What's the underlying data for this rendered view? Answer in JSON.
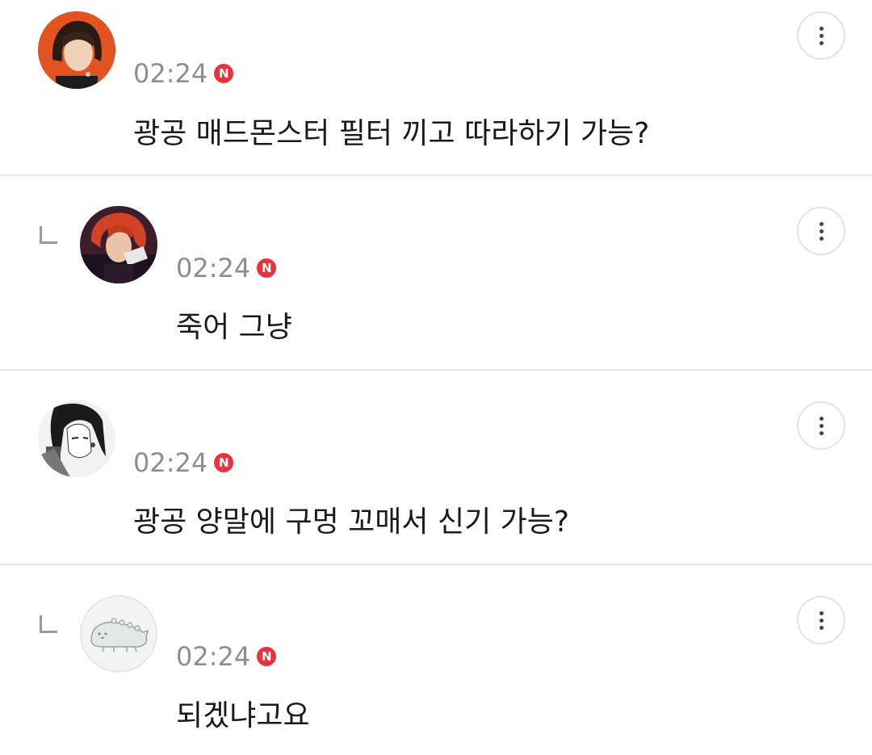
{
  "comments": [
    {
      "is_reply": false,
      "avatar_icon": "profile-photo-red-hair",
      "time": "02:24",
      "badge": "N",
      "text": "광공 매드몬스터 필터 끼고 따라하기 가능?",
      "more_icon": "more-vertical-icon"
    },
    {
      "is_reply": true,
      "avatar_icon": "profile-photo-stage",
      "time": "02:24",
      "badge": "N",
      "text": "죽어 그냥",
      "more_icon": "more-vertical-icon"
    },
    {
      "is_reply": false,
      "avatar_icon": "profile-photo-manga",
      "time": "02:24",
      "badge": "N",
      "text": "광공 양말에 구멍 꼬매서 신기 가능?",
      "more_icon": "more-vertical-icon"
    },
    {
      "is_reply": true,
      "avatar_icon": "default-avatar-creature",
      "time": "02:24",
      "badge": "N",
      "text": "되겠냐고요",
      "more_icon": "more-vertical-icon"
    }
  ],
  "colors": {
    "timestamp": "#8e8e8e",
    "badge": "#e8323c",
    "text": "#1a1a1a",
    "divider": "#e6e6e6"
  }
}
